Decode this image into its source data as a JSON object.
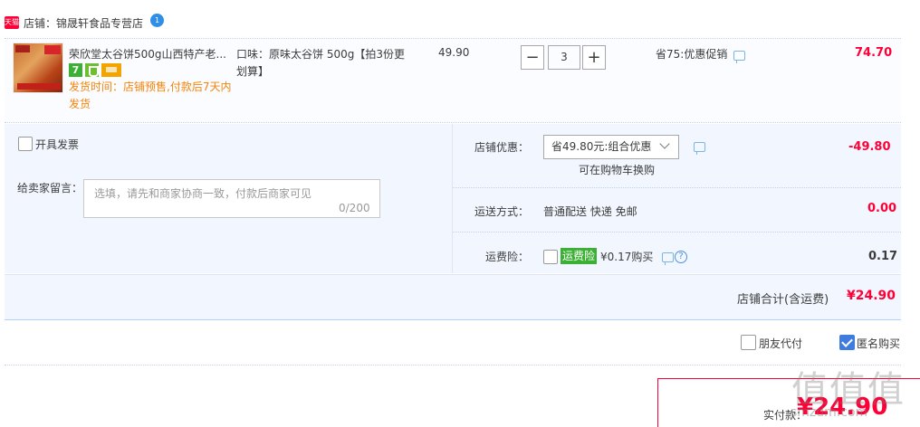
{
  "shop": {
    "badge": "天猫",
    "label": "店铺：锦晟轩食品专营店",
    "wangwang_icon": "1"
  },
  "item": {
    "title": "荣欣堂太谷饼500g山西特产老...",
    "ship_time": "发货时间：店铺预售,付款后7天内发货",
    "flavor": "口味：原味太谷饼 500g【拍3份更划算】",
    "unit_price": "49.90",
    "quantity": "3",
    "minus": "−",
    "plus": "+",
    "promo": "省75:优惠促销",
    "total": "74.70",
    "icon7": "7"
  },
  "order": {
    "invoice_label": "开具发票",
    "message_label": "给卖家留言：",
    "message_placeholder": "选填，请先和商家协商一致，付款后商家可见",
    "message_count": "0/200",
    "store_discount_label": "店铺优惠：",
    "store_discount_value": "省49.80元:组合优惠",
    "store_discount_note": "可在购物车换购",
    "store_discount_amount": "-49.80",
    "shipping_label": "运送方式：",
    "shipping_value": "普通配送 快递 免邮",
    "shipping_amount": "0.00",
    "insurance_label": "运费险：",
    "insurance_badge": "运费险",
    "insurance_price": "¥0.17购买",
    "insurance_amount": "0.17",
    "help_icon": "?"
  },
  "subtotal": {
    "label": "店铺合计(含运费)",
    "amount": "¥24.90"
  },
  "options": {
    "friend_pay": "朋友代付",
    "anonymous": "匿名购买",
    "anonymous_checked": true
  },
  "payment": {
    "label": "实付款：",
    "amount": "¥24.90"
  },
  "watermark": {
    "text": "值值值",
    "url": "smzdm.com"
  }
}
